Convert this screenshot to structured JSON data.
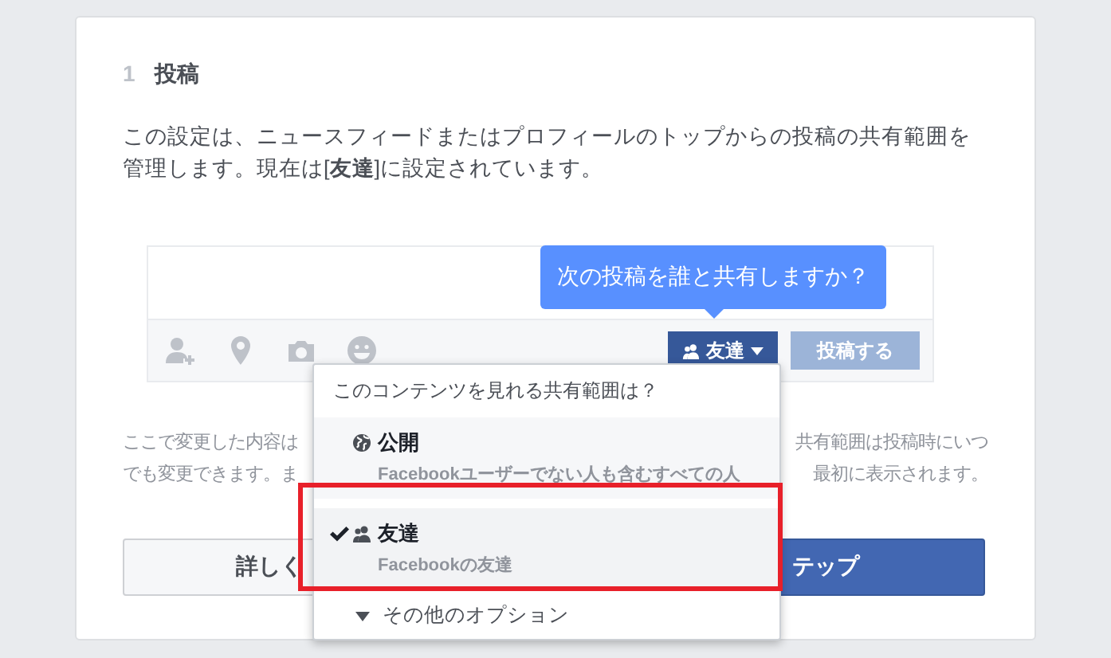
{
  "step": {
    "number": "1",
    "title": "投稿"
  },
  "description": "この設定は、ニュースフィードまたはプロフィールのトップからの投稿の共有範囲を管理します。現在は[**友達**]に設定されています。",
  "composer": {
    "tooltip": "次の投稿を誰と共有しますか？",
    "audience_button": "友達",
    "post_button": {
      "label": "投稿する",
      "disabled": true
    }
  },
  "note_lines": [
    {
      "left": "ここで変更した内容は",
      "right": "共有範囲は投稿時にいつ"
    },
    {
      "left": "でも変更できます。ま",
      "right": "最初に表示されます。"
    }
  ],
  "buttons": [
    {
      "label": "詳しく",
      "kind": "secondary"
    },
    {
      "label": "テップ",
      "kind": "primary"
    }
  ],
  "audience_menu": {
    "header": "このコンテンツを見れる共有範囲は？",
    "options": [
      {
        "kind": "globe",
        "label": "公開",
        "description": "Facebookユーザーでない人も含むすべての人",
        "selected": false
      },
      {
        "kind": "friends",
        "label": "友達",
        "description": "Facebookの友達",
        "selected": true
      }
    ],
    "more": "その他のオプション"
  },
  "highlight": {
    "on": true
  }
}
